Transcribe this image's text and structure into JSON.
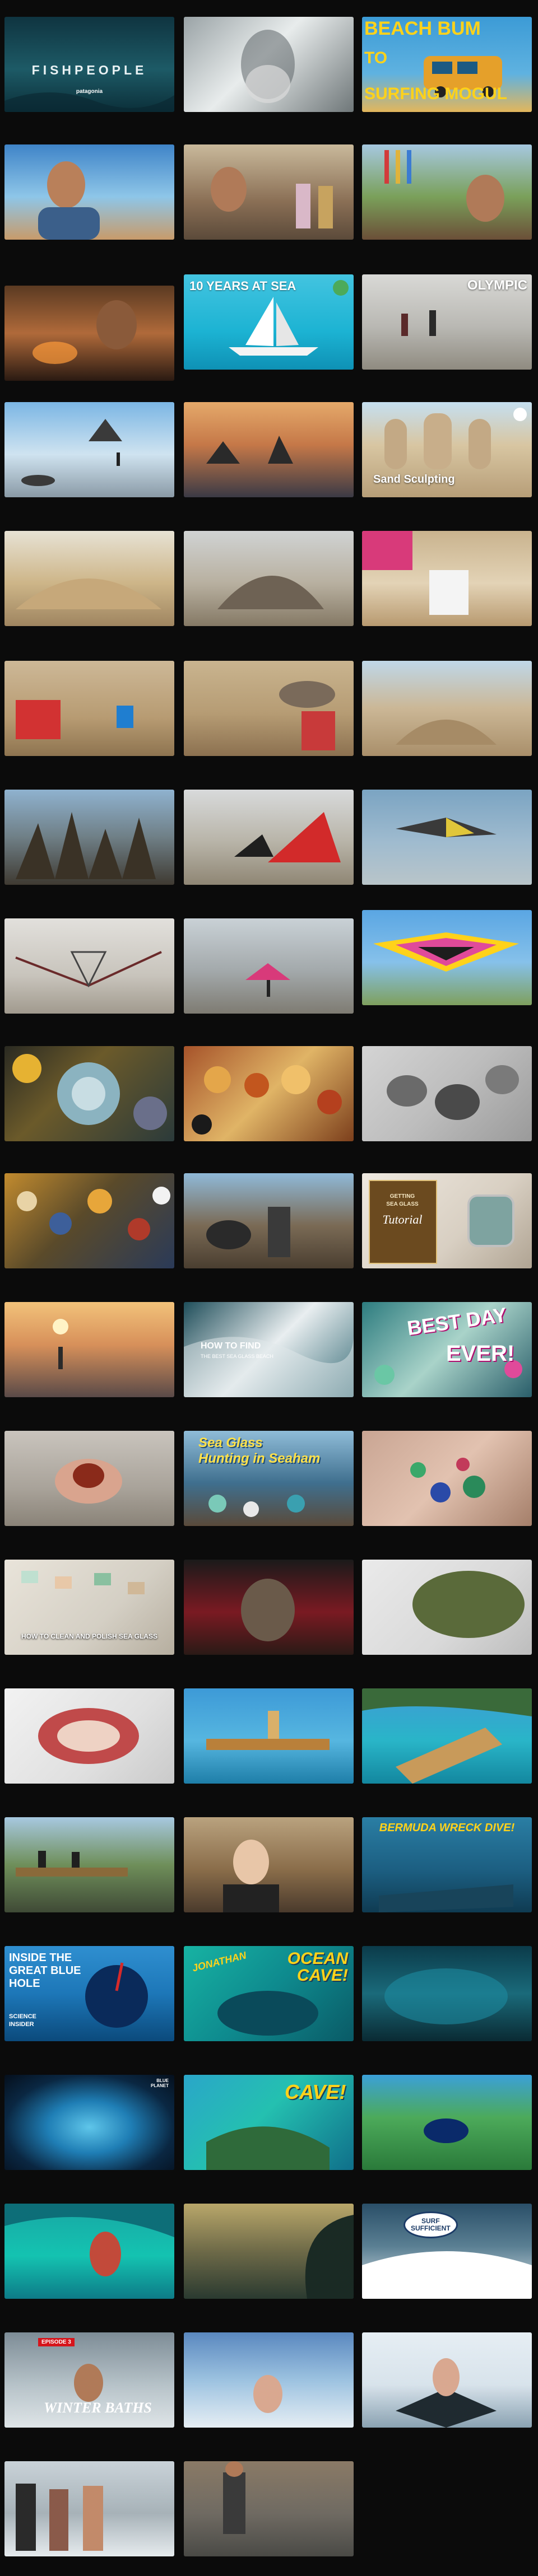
{
  "page": {
    "title": "Video thumbnail grid",
    "background": "#0b0b0b"
  },
  "thumbnails": [
    {
      "name": "fishpeople",
      "bg": "linear-gradient(180deg,#0f3440 0%,#1d5a66 55%,#0b2f39 100%)",
      "texts": [
        "FISHPEOPLE",
        "patagonia"
      ]
    },
    {
      "name": "bearded-man-underwater",
      "bg": "linear-gradient(135deg,#9aa3a6,#e8ecec 45%,#6f7779)",
      "texts": []
    },
    {
      "name": "beach-bum-to-surfing-mogul",
      "bg": "linear-gradient(180deg,#3c9bd6,#5fb2e0 60%,#e3b65b)",
      "texts": [
        "BEACH BUM",
        "TO",
        "SURFING MOGUL"
      ]
    },
    {
      "name": "selfie-peace-sign",
      "bg": "linear-gradient(180deg,#3f84c8,#8ec6e8 55%,#c89b6a)",
      "texts": []
    },
    {
      "name": "selfie-street-japan",
      "bg": "linear-gradient(180deg,#c9b99b,#8a6f55 60%,#5b4a3a)",
      "texts": []
    },
    {
      "name": "selfie-shrine-flags",
      "bg": "linear-gradient(180deg,#a6c8e0,#7aa05a 55%,#6b4f38)",
      "texts": []
    },
    {
      "name": "campfire-selfie",
      "bg": "linear-gradient(180deg,#5a3a22,#b06a3a 50%,#2a1a12)",
      "texts": []
    },
    {
      "name": "ten-years-at-sea",
      "bg": "linear-gradient(180deg,#43c4e0,#1cb3d3 60%,#0e91b5)",
      "texts": [
        "10 YEARS AT SEA"
      ]
    },
    {
      "name": "olympic-beach-walk",
      "bg": "linear-gradient(180deg,#d9d9d6,#b9b8b3 55%,#8f8b80)",
      "texts": [
        "OLYMPIC"
      ]
    },
    {
      "name": "sea-stacks-beach",
      "bg": "linear-gradient(180deg,#7bb6e4,#cfe3f0 55%,#8a9aa6)",
      "texts": []
    },
    {
      "name": "sunset-sea-stacks",
      "bg": "linear-gradient(180deg,#e5a96a,#c57848 45%,#3b3a45)",
      "texts": []
    },
    {
      "name": "sand-sculpting",
      "bg": "linear-gradient(180deg,#c5dff0,#d8c6a2 45%,#b79e78)",
      "texts": [
        "Sand Sculpting"
      ]
    },
    {
      "name": "sand-castle-sculpture",
      "bg": "linear-gradient(180deg,#e7e2d4,#cdb588 55%,#9f8560)",
      "texts": []
    },
    {
      "name": "sand-dragon-sculpture",
      "bg": "linear-gradient(180deg,#d0d3d3,#b8b0a0 55%,#857965)",
      "texts": []
    },
    {
      "name": "bucket-sand-pour",
      "bg": "linear-gradient(180deg,#c9b38e,#e3d3b6 55%,#b89a70)",
      "texts": []
    },
    {
      "name": "kids-building-sand",
      "bg": "linear-gradient(180deg,#cdb897,#b79b72 60%,#8e7450)",
      "texts": []
    },
    {
      "name": "sand-castle-towers",
      "bg": "linear-gradient(180deg,#c9b48f,#b69c74 55%,#8c7150)",
      "texts": []
    },
    {
      "name": "sand-pile-beach",
      "bg": "linear-gradient(180deg,#bfd7e8,#cbb796 50%,#a98f6a)",
      "texts": []
    },
    {
      "name": "drip-castle",
      "bg": "linear-gradient(180deg,#8fb2cf,#6f7f86 50%,#3f3a32)",
      "texts": []
    },
    {
      "name": "kites-on-beach",
      "bg": "linear-gradient(180deg,#d8dadb,#b8b4a8 55%,#8f8674)",
      "texts": []
    },
    {
      "name": "stunt-kite-sky",
      "bg": "linear-gradient(180deg,#7ba4c2,#9fbbcf 55%,#b9c5c9)",
      "texts": []
    },
    {
      "name": "kite-indoors",
      "bg": "linear-gradient(180deg,#e2e0dc,#c8c4bc 60%,#a19a8e)",
      "texts": []
    },
    {
      "name": "kite-flyer-beach",
      "bg": "linear-gradient(180deg,#c9d1d6,#a3a9ab 55%,#7e7b72)",
      "texts": []
    },
    {
      "name": "big-stunt-kite",
      "bg": "linear-gradient(180deg,#5aa6e3,#86c1ea 55%,#7fa05d)",
      "texts": []
    },
    {
      "name": "beach-glass-pebbles",
      "bg": "linear-gradient(135deg,#2a2a22,#6b5a2a 40%,#2b3a3a)",
      "texts": []
    },
    {
      "name": "agate-stones",
      "bg": "linear-gradient(135deg,#a6532a,#e0b466 50%,#7c3f1c)",
      "texts": []
    },
    {
      "name": "pebbles-macro",
      "bg": "linear-gradient(135deg,#d4d4d4,#bdbdbd 50%,#9a9a9a)",
      "texts": []
    },
    {
      "name": "colorful-pebbles",
      "bg": "linear-gradient(135deg,#c28b2e,#5a4a2a 45%,#2a3a58)",
      "texts": []
    },
    {
      "name": "beachcomber-driftwood",
      "bg": "linear-gradient(180deg,#8fb9d8,#7a6a55 55%,#4a3e30)",
      "texts": []
    },
    {
      "name": "getting-sea-glass-tutorial",
      "bg": "linear-gradient(135deg,#efe9e0,#d8cfc2 60%,#b0a493)",
      "texts": [
        "GETTING",
        "SEA GLASS",
        "Tutorial"
      ]
    },
    {
      "name": "sunset-shore",
      "bg": "linear-gradient(180deg,#f2c27a,#d7905a 45%,#5a4a48)",
      "texts": []
    },
    {
      "name": "how-to-find-sea-glass",
      "bg": "linear-gradient(135deg,#1f4e5a,#e9eef0 50%,#3b6f7a)",
      "texts": [
        "HOW TO FIND",
        "THE BEST SEA GLASS BEACH"
      ]
    },
    {
      "name": "best-day-ever",
      "bg": "linear-gradient(135deg,#2d7c7f,#a9d3c9 50%,#2a5e6a)",
      "texts": [
        "BEST DAY",
        "EVER!"
      ]
    },
    {
      "name": "hand-holding-stone",
      "bg": "linear-gradient(180deg,#c9c4bd,#a9a39a 60%,#8a8378)",
      "texts": []
    },
    {
      "name": "sea-glass-hunting-seaham",
      "bg": "linear-gradient(180deg,#8fbcd8,#3f6f8e 55%,#5a4a3a)",
      "texts": [
        "Sea Glass",
        "Hunting in Seaham"
      ]
    },
    {
      "name": "sea-glass-in-palm",
      "bg": "linear-gradient(135deg,#c9a593,#e2c2b0 50%,#a57f6a)",
      "texts": []
    },
    {
      "name": "how-to-clean-sea-glass",
      "bg": "linear-gradient(135deg,#e9e4da,#d4cfc4 60%,#b6ae9f)",
      "texts": [
        "HOW TO CLEAN AND POLISH SEA GLASS"
      ]
    },
    {
      "name": "polished-stone-hands",
      "bg": "linear-gradient(180deg,#1a1a1a,#7a1a22 55%,#2a1a16)",
      "texts": []
    },
    {
      "name": "green-jasper-stone",
      "bg": "linear-gradient(135deg,#eaeaea,#d9d9d9 60%,#bdbdbd)",
      "texts": []
    },
    {
      "name": "red-agate-slice",
      "bg": "linear-gradient(135deg,#f2f2f2,#e0e0e0 60%,#cacaca)",
      "texts": []
    },
    {
      "name": "raft-on-water",
      "bg": "linear-gradient(180deg,#3d9ad7,#56b6e0 55%,#1e7ea8)",
      "texts": []
    },
    {
      "name": "bamboo-raft-aerial",
      "bg": "linear-gradient(180deg,#3f9bd5,#29b5c8 55%,#13879f)",
      "texts": []
    },
    {
      "name": "raft-crew-river",
      "bg": "linear-gradient(180deg,#a7c8e0,#6f8f5a 50%,#3f4a36)",
      "texts": []
    },
    {
      "name": "smiling-woman-boatyard",
      "bg": "linear-gradient(180deg,#b9a27e,#8a6d4a 55%,#4a3a2c)",
      "texts": []
    },
    {
      "name": "bermuda-wreck-dive",
      "bg": "linear-gradient(180deg,#2a7ea4,#1c5f82 55%,#0f3b52)",
      "texts": [
        "BERMUDA WRECK DIVE!"
      ]
    },
    {
      "name": "inside-the-great-blue-hole",
      "bg": "linear-gradient(180deg,#2f8fd0,#1d77b8 50%,#0b4a7c)",
      "texts": [
        "INSIDE THE",
        "GREAT BLUE",
        "HOLE",
        "SCIENCE",
        "INSIDER"
      ]
    },
    {
      "name": "jonathan-ocean-cave",
      "bg": "linear-gradient(135deg,#17b3a3,#0e8a8e 50%,#0a5a66)",
      "texts": [
        "JONATHAN",
        "OCEAN",
        "CAVE!"
      ]
    },
    {
      "name": "diver-cave-underwater",
      "bg": "linear-gradient(180deg,#0b3b4a,#1a6a7a 50%,#0a2a33)",
      "texts": []
    },
    {
      "name": "underwater-cave-opening",
      "bg": "radial-gradient(ellipse at 50% 55%,#5fc6ea 0%,#1f7eb5 35%,#0a2742 70%,#050f1c 100%)",
      "texts": [
        "BLUE",
        "PLANET"
      ]
    },
    {
      "name": "cave-aerial-island",
      "bg": "linear-gradient(135deg,#2aa6c9,#24c0b0 45%,#0f6f8a)",
      "texts": [
        "CAVE!"
      ]
    },
    {
      "name": "blue-hole-aerial",
      "bg": "linear-gradient(180deg,#3ba0d8,#4caa5a 45%,#2a7a3a)",
      "texts": []
    },
    {
      "name": "surfer-wave",
      "bg": "linear-gradient(180deg,#18a7a4,#14c3b1 55%,#0d7b87)",
      "texts": []
    },
    {
      "name": "barrel-wave-sunset",
      "bg": "linear-gradient(180deg,#b9a76a,#6e6a48 50%,#2a3a30)",
      "texts": []
    },
    {
      "name": "surf-sufficient",
      "bg": "linear-gradient(180deg,#2a4f68,#5a7f93 45%,#e8eef1)",
      "texts": [
        "SURF",
        "SUFFICIENT"
      ]
    },
    {
      "name": "winter-baths",
      "bg": "linear-gradient(180deg,#7d8c96,#b6c2c8 55%,#dfe5e8)",
      "texts": [
        "EPISODE 3",
        "WINTER BATHS"
      ]
    },
    {
      "name": "ice-bath-lake",
      "bg": "linear-gradient(180deg,#5a88bf,#9cc2e0 50%,#e6eef4)",
      "texts": []
    },
    {
      "name": "ice-hole-swim",
      "bg": "linear-gradient(180deg,#e6eef4,#d8e3eb 55%,#8aa2b2)",
      "texts": []
    },
    {
      "name": "winter-swimmers-snow",
      "bg": "linear-gradient(180deg,#c9d2d8,#a7b2b8 55%,#e6ebee)",
      "texts": []
    },
    {
      "name": "man-on-tidal-flat",
      "bg": "linear-gradient(180deg,#8a7a66,#6f6a62 55%,#4a4a46)",
      "texts": []
    }
  ]
}
